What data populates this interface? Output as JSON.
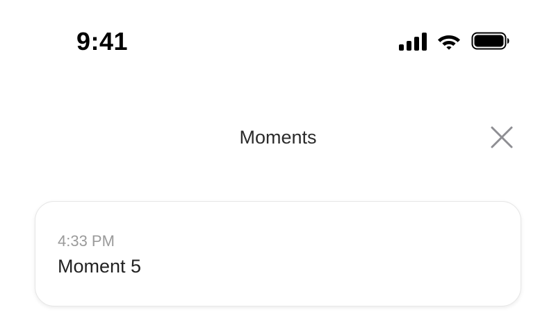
{
  "status_bar": {
    "time": "9:41",
    "icons": [
      "cellular-signal-icon",
      "wifi-icon",
      "battery-icon"
    ]
  },
  "header": {
    "title": "Moments",
    "close_icon": "close-icon"
  },
  "moments": [
    {
      "time": "4:33 PM",
      "title": "Moment 5"
    }
  ],
  "colors": {
    "background": "#ffffff",
    "title_text": "#2b2b2b",
    "secondary_text": "#9a9a9a",
    "close_icon": "#8e8e93",
    "card_border": "#e6e6e6"
  }
}
